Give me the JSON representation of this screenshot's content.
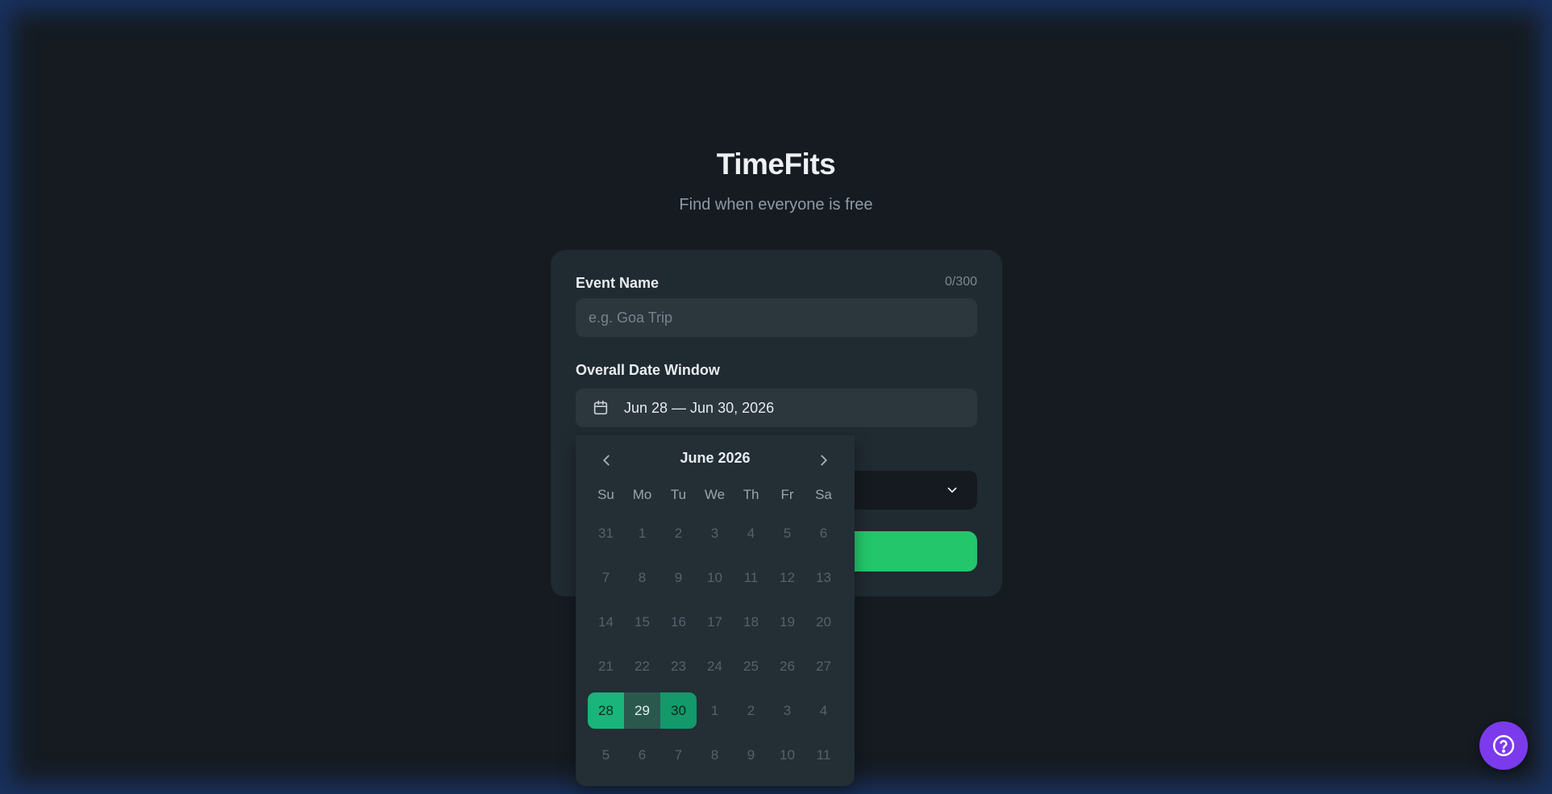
{
  "header": {
    "title": "TimeFits",
    "subtitle": "Find when everyone is free"
  },
  "form": {
    "event_name_label": "Event Name",
    "event_name_counter": "0/300",
    "event_name_placeholder": "e.g. Goa Trip",
    "event_name_value": "",
    "date_window_label": "Overall Date Window",
    "date_window_value": "Jun 28 — Jun 30, 2026"
  },
  "calendar": {
    "month_label": "June 2026",
    "weekdays": [
      "Su",
      "Mo",
      "Tu",
      "We",
      "Th",
      "Fr",
      "Sa"
    ],
    "weeks": [
      [
        "31",
        "1",
        "2",
        "3",
        "4",
        "5",
        "6"
      ],
      [
        "7",
        "8",
        "9",
        "10",
        "11",
        "12",
        "13"
      ],
      [
        "14",
        "15",
        "16",
        "17",
        "18",
        "19",
        "20"
      ],
      [
        "21",
        "22",
        "23",
        "24",
        "25",
        "26",
        "27"
      ],
      [
        "28",
        "29",
        "30",
        "1",
        "2",
        "3",
        "4"
      ],
      [
        "5",
        "6",
        "7",
        "8",
        "9",
        "10",
        "11"
      ]
    ],
    "selected_start": "28",
    "selected_end": "30"
  },
  "icons": {
    "date": "calendar-icon",
    "prev": "chevron-left-icon",
    "next": "chevron-right-icon",
    "dropdown": "chevron-down-icon",
    "help": "help-icon"
  },
  "colors": {
    "accent_green": "#23c66a",
    "range_start": "#19b57a",
    "range_mid": "#2b584c",
    "range_end": "#13996a",
    "help_purple": "#7c3aed"
  }
}
